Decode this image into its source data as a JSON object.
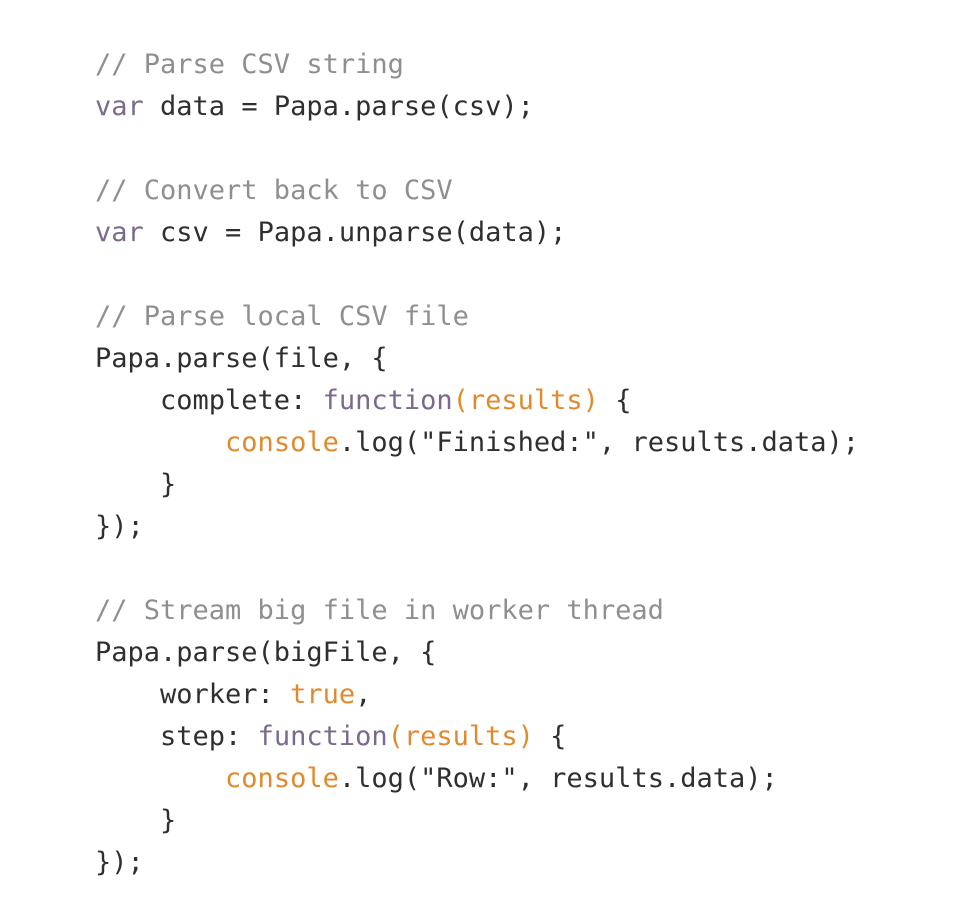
{
  "colors": {
    "background": "#ffffff",
    "text": "#2f2f2f",
    "comment": "#8f8f8f",
    "keyword": "#7b6a8d",
    "highlight": "#e08a2e"
  },
  "code_lines": [
    [
      {
        "t": "// Parse CSV string",
        "c": "comment"
      }
    ],
    [
      {
        "t": "var",
        "c": "keyword"
      },
      {
        "t": " data = Papa.parse(csv);",
        "c": "plain"
      }
    ],
    [],
    [
      {
        "t": "// Convert back to CSV",
        "c": "comment"
      }
    ],
    [
      {
        "t": "var",
        "c": "keyword"
      },
      {
        "t": " csv = Papa.unparse(data);",
        "c": "plain"
      }
    ],
    [],
    [
      {
        "t": "// Parse local CSV file",
        "c": "comment"
      }
    ],
    [
      {
        "t": "Papa.parse(file, {",
        "c": "plain"
      }
    ],
    [
      {
        "t": "    complete: ",
        "c": "plain"
      },
      {
        "t": "function",
        "c": "keyword"
      },
      {
        "t": "(results)",
        "c": "param"
      },
      {
        "t": " {",
        "c": "plain"
      }
    ],
    [
      {
        "t": "        ",
        "c": "plain"
      },
      {
        "t": "console",
        "c": "param"
      },
      {
        "t": ".log(\"Finished:\", results.data);",
        "c": "plain"
      }
    ],
    [
      {
        "t": "    }",
        "c": "plain"
      }
    ],
    [
      {
        "t": "});",
        "c": "plain"
      }
    ],
    [],
    [
      {
        "t": "// Stream big file in worker thread",
        "c": "comment"
      }
    ],
    [
      {
        "t": "Papa.parse(bigFile, {",
        "c": "plain"
      }
    ],
    [
      {
        "t": "    worker: ",
        "c": "plain"
      },
      {
        "t": "true",
        "c": "param"
      },
      {
        "t": ",",
        "c": "plain"
      }
    ],
    [
      {
        "t": "    step: ",
        "c": "plain"
      },
      {
        "t": "function",
        "c": "keyword"
      },
      {
        "t": "(results)",
        "c": "param"
      },
      {
        "t": " {",
        "c": "plain"
      }
    ],
    [
      {
        "t": "        ",
        "c": "plain"
      },
      {
        "t": "console",
        "c": "param"
      },
      {
        "t": ".log(\"Row:\", results.data);",
        "c": "plain"
      }
    ],
    [
      {
        "t": "    }",
        "c": "plain"
      }
    ],
    [
      {
        "t": "});",
        "c": "plain"
      }
    ]
  ]
}
